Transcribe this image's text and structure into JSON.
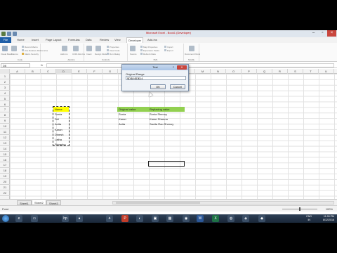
{
  "app": {
    "title": "Microsoft Excel - Book1 (Developer)"
  },
  "ribbon": {
    "tabs": [
      {
        "label": "File"
      },
      {
        "label": "Home"
      },
      {
        "label": "Insert"
      },
      {
        "label": "Page Layout"
      },
      {
        "label": "Formulas"
      },
      {
        "label": "Data"
      },
      {
        "label": "Review"
      },
      {
        "label": "View"
      },
      {
        "label": "Developer"
      },
      {
        "label": "Add-Ins"
      }
    ],
    "groups": [
      {
        "label": "Code"
      },
      {
        "label": "Add-Ins"
      },
      {
        "label": "Controls"
      },
      {
        "label": "XML"
      },
      {
        "label": "Modify"
      }
    ],
    "items": {
      "visual_basic": "Visual Basic",
      "macros": "Macros",
      "record_macro": "Record Macro",
      "relative_refs": "Use Relative References",
      "macro_security": "Macro Security",
      "addins": "Add-Ins",
      "com_addins": "COM Add-Ins",
      "insert": "Insert",
      "design_mode": "Design Mode",
      "properties": "Properties",
      "view_code": "View Code",
      "run_dialog": "Run Dialog",
      "source": "Source",
      "map_properties": "Map Properties",
      "expansion_packs": "Expansion Packs",
      "refresh_data": "Refresh Data",
      "import": "Import",
      "export": "Export",
      "document_panel": "Document Panel"
    }
  },
  "formula_bar": {
    "name_box": "D6",
    "fx": "fx",
    "content": ""
  },
  "columns": [
    "A",
    "B",
    "C",
    "D",
    "E",
    "F",
    "G",
    "H",
    "I",
    "J",
    "K",
    "L",
    "M",
    "N",
    "O",
    "P",
    "Q",
    "R",
    "S",
    "T",
    "U"
  ],
  "rows": [
    "1",
    "2",
    "3",
    "4",
    "5",
    "6",
    "7",
    "8",
    "9",
    "10",
    "11",
    "12",
    "13",
    "14",
    "15",
    "16",
    "17",
    "18",
    "19",
    "20",
    "21",
    "22"
  ],
  "sheet": {
    "col_d": [
      "Name",
      "Sonia",
      "Sid",
      "Anita",
      "Karan",
      "Dinesh",
      "Latha",
      "Priyanka"
    ],
    "original_header": "Original value",
    "replacing_header": "Replacing value",
    "original_values": [
      "Sonia",
      "Karan",
      "Anita"
    ],
    "replacing_values": [
      "Sonia Shenoy",
      "Karan Sharma",
      "Savita Rao Shenoy"
    ]
  },
  "dialog": {
    "title": "Test",
    "help": "?",
    "close": "X",
    "label": "Original Range",
    "value": "$D$8:$D$14",
    "ok": "OK",
    "cancel": "Cancel"
  },
  "sheet_tabs": [
    {
      "label": "Sheet1"
    },
    {
      "label": "Sheet2"
    },
    {
      "label": "Sheet3"
    }
  ],
  "status": {
    "text": "Point",
    "zoom": "100%"
  },
  "taskbar": {
    "lang": "ENG\nIN",
    "time": "11:28 PM",
    "date": "8/12/2016"
  }
}
